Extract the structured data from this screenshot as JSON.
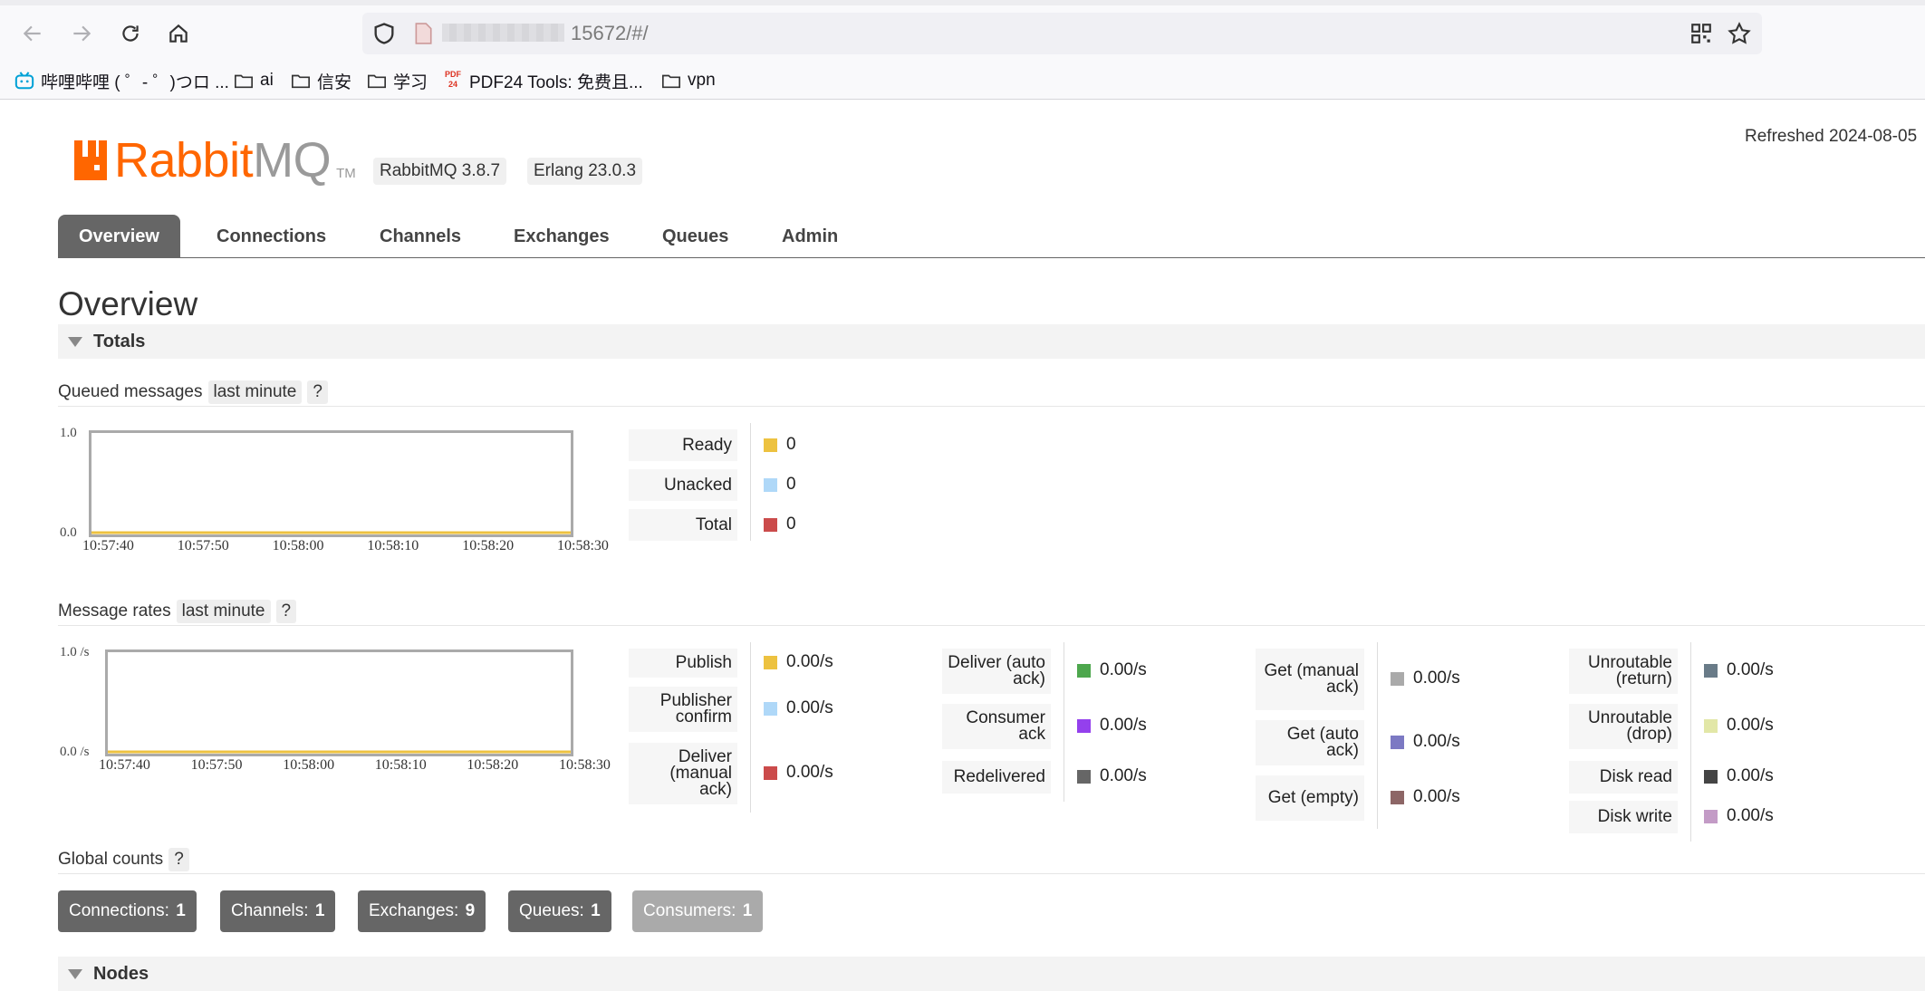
{
  "browser": {
    "url": "15672/#/",
    "bookmarks": [
      "哔哩哔哩 ( ゜- ゜)つロ ...",
      "ai",
      "信安",
      "学习",
      "PDF24 Tools: 免费且...",
      "vpn"
    ]
  },
  "header": {
    "logo_primary": "Rabbit",
    "logo_secondary": "MQ",
    "logo_tm": "TM",
    "rabbitmq_version": "RabbitMQ 3.8.7",
    "erlang_version": "Erlang 23.0.3",
    "refreshed": "Refreshed 2024-08-05"
  },
  "tabs": [
    "Overview",
    "Connections",
    "Channels",
    "Exchanges",
    "Queues",
    "Admin"
  ],
  "active_tab": "Overview",
  "page_title": "Overview",
  "totals": {
    "label": "Totals",
    "queued": {
      "title": "Queued messages",
      "range": "last minute",
      "help": "?",
      "chart_data": {
        "type": "line",
        "x": [
          "10:57:40",
          "10:57:50",
          "10:58:00",
          "10:58:10",
          "10:58:20",
          "10:58:30"
        ],
        "ylim": [
          0.0,
          1.0
        ],
        "y_ticks": [
          "1.0",
          "0.0"
        ],
        "series": [
          {
            "name": "Ready",
            "color": "#edc240",
            "values": [
              0,
              0,
              0,
              0,
              0,
              0
            ]
          },
          {
            "name": "Unacked",
            "color": "#afd8f8",
            "values": [
              0,
              0,
              0,
              0,
              0,
              0
            ]
          },
          {
            "name": "Total",
            "color": "#cb4b4b",
            "values": [
              0,
              0,
              0,
              0,
              0,
              0
            ]
          }
        ]
      },
      "legend": [
        {
          "label": "Ready",
          "value": "0",
          "color": "#edc240"
        },
        {
          "label": "Unacked",
          "value": "0",
          "color": "#afd8f8"
        },
        {
          "label": "Total",
          "value": "0",
          "color": "#cb4b4b"
        }
      ]
    },
    "rates": {
      "title": "Message rates",
      "range": "last minute",
      "help": "?",
      "chart_data": {
        "type": "line",
        "x": [
          "10:57:40",
          "10:57:50",
          "10:58:00",
          "10:58:10",
          "10:58:20",
          "10:58:30"
        ],
        "ylim": [
          0.0,
          1.0
        ],
        "y_ticks": [
          "1.0 /s",
          "0.0 /s"
        ],
        "series": [
          {
            "name": "Publish",
            "color": "#edc240",
            "values": [
              0,
              0,
              0,
              0,
              0,
              0
            ]
          },
          {
            "name": "Publisher confirm",
            "color": "#afd8f8",
            "values": [
              0,
              0,
              0,
              0,
              0,
              0
            ]
          },
          {
            "name": "Deliver (manual ack)",
            "color": "#cb4b4b",
            "values": [
              0,
              0,
              0,
              0,
              0,
              0
            ]
          },
          {
            "name": "Deliver (auto ack)",
            "color": "#4da74d",
            "values": [
              0,
              0,
              0,
              0,
              0,
              0
            ]
          },
          {
            "name": "Consumer ack",
            "color": "#9440ed",
            "values": [
              0,
              0,
              0,
              0,
              0,
              0
            ]
          },
          {
            "name": "Redelivered",
            "color": "#666666",
            "values": [
              0,
              0,
              0,
              0,
              0,
              0
            ]
          },
          {
            "name": "Get (manual ack)",
            "color": "#aaaaaa",
            "values": [
              0,
              0,
              0,
              0,
              0,
              0
            ]
          },
          {
            "name": "Get (auto ack)",
            "color": "#7c79c3",
            "values": [
              0,
              0,
              0,
              0,
              0,
              0
            ]
          },
          {
            "name": "Get (empty)",
            "color": "#8d6666",
            "values": [
              0,
              0,
              0,
              0,
              0,
              0
            ]
          },
          {
            "name": "Unroutable (return)",
            "color": "#697b88",
            "values": [
              0,
              0,
              0,
              0,
              0,
              0
            ]
          },
          {
            "name": "Unroutable (drop)",
            "color": "#e2e7a7",
            "values": [
              0,
              0,
              0,
              0,
              0,
              0
            ]
          },
          {
            "name": "Disk read",
            "color": "#444444",
            "values": [
              0,
              0,
              0,
              0,
              0,
              0
            ]
          },
          {
            "name": "Disk write",
            "color": "#c39bc6",
            "values": [
              0,
              0,
              0,
              0,
              0,
              0
            ]
          }
        ]
      },
      "legend_columns": [
        [
          {
            "label": "Publish",
            "value": "0.00/s",
            "color": "#edc240"
          },
          {
            "label": "Publisher confirm",
            "value": "0.00/s",
            "color": "#afd8f8"
          },
          {
            "label": "Deliver (manual ack)",
            "value": "0.00/s",
            "color": "#cb4b4b"
          }
        ],
        [
          {
            "label": "Deliver (auto ack)",
            "value": "0.00/s",
            "color": "#4da74d"
          },
          {
            "label": "Consumer ack",
            "value": "0.00/s",
            "color": "#9440ed"
          },
          {
            "label": "Redelivered",
            "value": "0.00/s",
            "color": "#666666"
          }
        ],
        [
          {
            "label": "Get (manual ack)",
            "value": "0.00/s",
            "color": "#aaaaaa"
          },
          {
            "label": "Get (auto ack)",
            "value": "0.00/s",
            "color": "#7c79c3"
          },
          {
            "label": "Get (empty)",
            "value": "0.00/s",
            "color": "#8d6666"
          }
        ],
        [
          {
            "label": "Unroutable (return)",
            "value": "0.00/s",
            "color": "#697b88"
          },
          {
            "label": "Unroutable (drop)",
            "value": "0.00/s",
            "color": "#e2e7a7"
          },
          {
            "label": "Disk read",
            "value": "0.00/s",
            "color": "#444444"
          },
          {
            "label": "Disk write",
            "value": "0.00/s",
            "color": "#c39bc6"
          }
        ]
      ]
    },
    "global_counts": {
      "title": "Global counts",
      "help": "?",
      "items": [
        {
          "label": "Connections:",
          "value": "1"
        },
        {
          "label": "Channels:",
          "value": "1"
        },
        {
          "label": "Exchanges:",
          "value": "9"
        },
        {
          "label": "Queues:",
          "value": "1"
        },
        {
          "label": "Consumers:",
          "value": "1"
        }
      ]
    }
  },
  "nodes": {
    "label": "Nodes"
  }
}
